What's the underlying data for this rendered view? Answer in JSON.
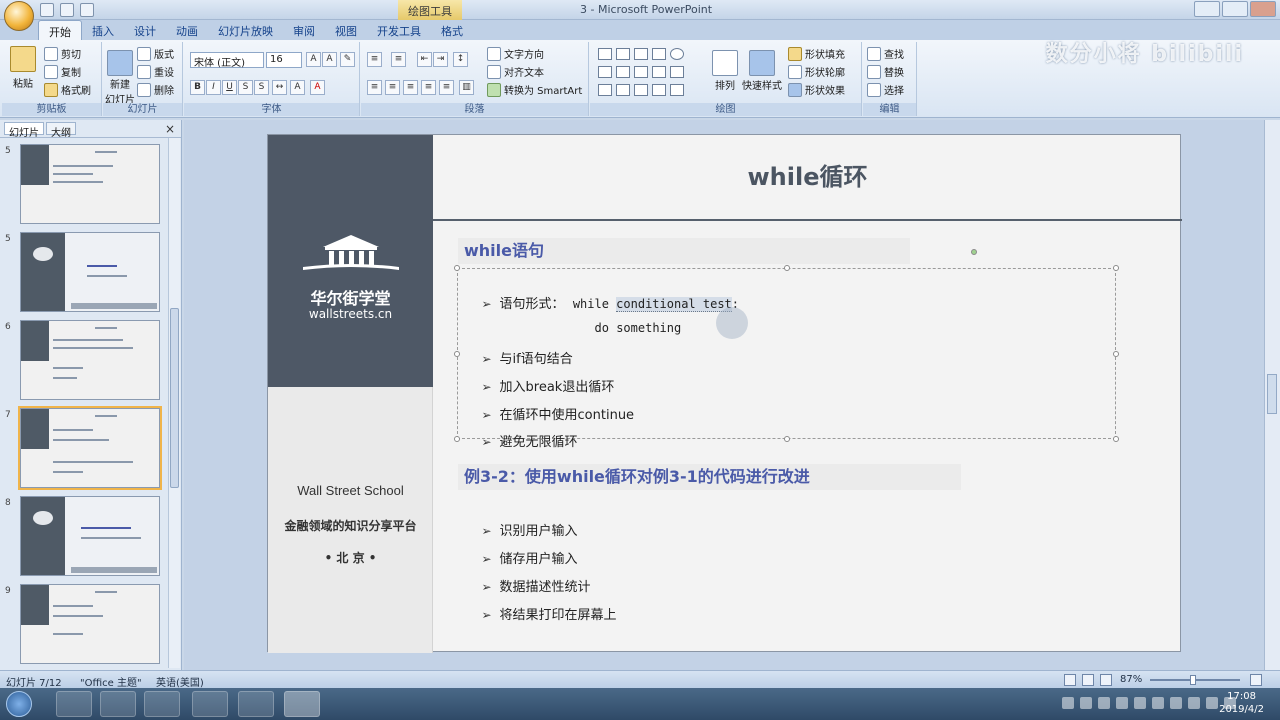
{
  "window": {
    "context_tab": "绘图工具",
    "doc_title": "3 - Microsoft PowerPoint"
  },
  "ribbon_tabs": [
    "开始",
    "插入",
    "设计",
    "动画",
    "幻灯片放映",
    "审阅",
    "视图",
    "开发工具",
    "格式"
  ],
  "ribbon": {
    "clipboard": {
      "paste": "粘贴",
      "cut": "剪切",
      "copy": "复制",
      "format_painter": "格式刷",
      "group": "剪贴板"
    },
    "slides": {
      "new_slide": "新建",
      "new_slide2": "幻灯片",
      "layout": "版式",
      "reset": "重设",
      "delete": "删除",
      "group": "幻灯片"
    },
    "font": {
      "name": "宋体 (正文)",
      "size": "16",
      "group": "字体"
    },
    "paragraph": {
      "text_direction": "文字方向",
      "align_text": "对齐文本",
      "smartart": "转换为 SmartArt",
      "group": "段落"
    },
    "drawing": {
      "arrange": "排列",
      "quick_styles": "快速样式",
      "fill": "形状填充",
      "outline": "形状轮廓",
      "effects": "形状效果",
      "group": "绘图"
    },
    "editing": {
      "find": "查找",
      "replace": "替换",
      "select": "选择",
      "group": "编辑"
    }
  },
  "watermark": "数分小将 bilibili",
  "left_panel": {
    "tab_slides": "幻灯片",
    "tab_outline": "大纲",
    "close": "×",
    "thumb_numbers": [
      "5",
      "5",
      "6",
      "7",
      "8",
      "9"
    ]
  },
  "slide": {
    "title": "while循环",
    "brand_cn": "华尔街学堂",
    "brand_url": "wallstreets.cn",
    "school_en": "Wall Street School",
    "tagline": "金融领域的知识分享平台",
    "city": "• 北 京 •",
    "section1": "while语句",
    "bullets1": [
      {
        "label": "语句形式：",
        "code1": "while ",
        "code_sel": "conditional test",
        "code2": ":"
      },
      {
        "indent_code": "do something"
      },
      {
        "text": "与if语句结合"
      },
      {
        "text": "加入break退出循环"
      },
      {
        "text": "在循环中使用continue"
      },
      {
        "text": "避免无限循环"
      }
    ],
    "section2": "例3-2：使用while循环对例3-1的代码进行改进",
    "bullets2": [
      "识别用户输入",
      "储存用户输入",
      "数据描述性统计",
      "将结果打印在屏幕上"
    ]
  },
  "statusbar": {
    "slide_pos": "幻灯片 7/12",
    "theme": "\"Office 主题\"",
    "lang": "英语(美国)",
    "zoom": "87%"
  },
  "taskbar": {
    "time": "17:08",
    "date": "2019/4/2"
  }
}
